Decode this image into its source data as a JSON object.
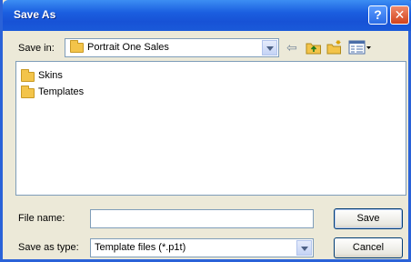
{
  "window": {
    "title": "Save As",
    "help_glyph": "?",
    "close_glyph": "✕"
  },
  "toolbar": {
    "save_in_label": "Save in:",
    "save_in_value": "Portrait One Sales",
    "back_glyph": "⇦"
  },
  "file_list": {
    "items": [
      {
        "label": "Skins",
        "icon": "folder-icon"
      },
      {
        "label": "Templates",
        "icon": "folder-icon"
      }
    ]
  },
  "footer": {
    "file_name_label": "File name:",
    "file_name_value": "",
    "save_as_type_label": "Save as type:",
    "save_as_type_value": "Template files (*.p1t)",
    "save_button": "Save",
    "cancel_button": "Cancel"
  },
  "colors": {
    "title_bar": "#1b5fe0",
    "dialog_bg": "#ece9d8",
    "folder": "#f3c44a",
    "close": "#d2431c"
  }
}
